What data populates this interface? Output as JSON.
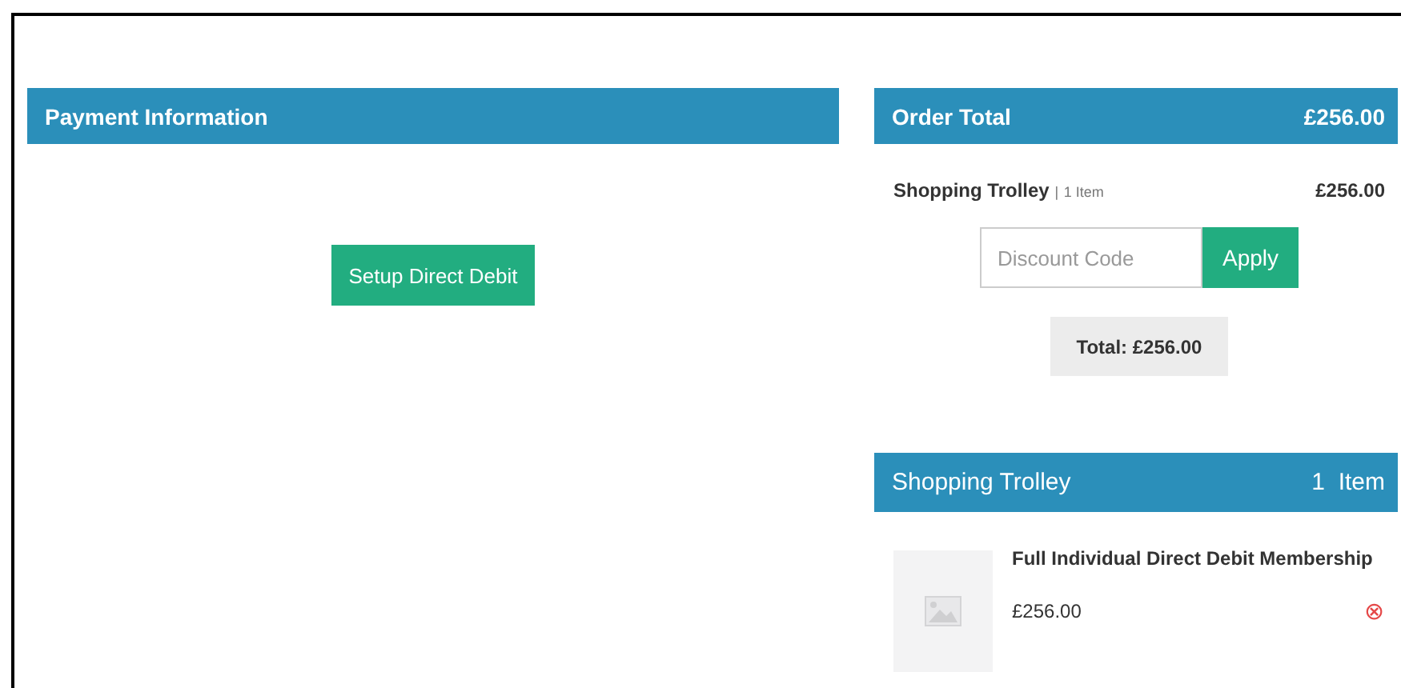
{
  "payment": {
    "title": "Payment Information",
    "button": "Setup Direct Debit"
  },
  "order_total": {
    "title": "Order Total",
    "amount": "£256.00",
    "trolley_label": "Shopping Trolley",
    "trolley_sep": "|",
    "trolley_count": "1 Item",
    "trolley_amount": "£256.00",
    "discount": {
      "placeholder": "Discount Code"
    },
    "apply": "Apply",
    "total": "Total: £256.00"
  },
  "trolley": {
    "title": "Shopping Trolley",
    "count": "1  Item",
    "items": [
      {
        "kind": "picture",
        "name": "Full Individual Direct Debit Membership",
        "price": "£256.00",
        "remove": "⊗"
      }
    ]
  }
}
